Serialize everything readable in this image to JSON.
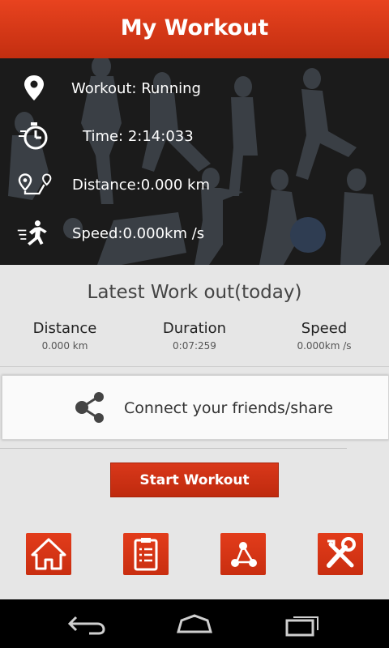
{
  "header": {
    "title": "My Workout"
  },
  "workout_info": {
    "workout": "Workout: Running",
    "time": "Time:  2:14:033",
    "distance": "Distance:0.000 km",
    "speed": "Speed:0.000km /s"
  },
  "latest": {
    "title": "Latest Work out(today)",
    "stats": [
      {
        "label": "Distance",
        "value": "0.000 km"
      },
      {
        "label": "Duration",
        "value": "0:07:259"
      },
      {
        "label": "Speed",
        "value": "0.000km /s"
      }
    ]
  },
  "share": {
    "label": "Connect your friends/share"
  },
  "start_button": {
    "label": "Start Workout"
  },
  "colors": {
    "accent": "#d9381a",
    "header": "#e8431f",
    "hero_bg": "#1b1b1b"
  },
  "bottom_tabs": [
    {
      "icon": "home-icon"
    },
    {
      "icon": "clipboard-icon"
    },
    {
      "icon": "share-icon"
    },
    {
      "icon": "tools-icon"
    }
  ],
  "system_nav": [
    {
      "icon": "back-icon"
    },
    {
      "icon": "home-icon"
    },
    {
      "icon": "recent-apps-icon"
    }
  ]
}
